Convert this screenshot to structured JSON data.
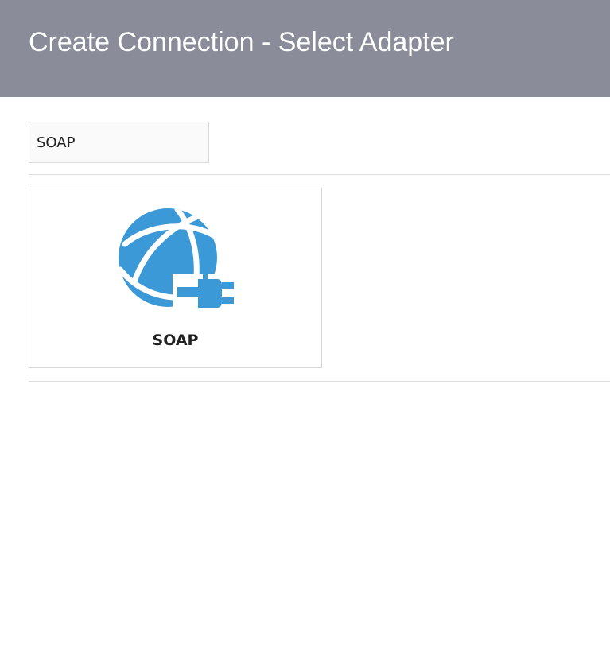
{
  "header": {
    "title": "Create Connection - Select Adapter"
  },
  "search": {
    "value": "SOAP",
    "placeholder": ""
  },
  "adapters": [
    {
      "label": "SOAP",
      "icon": "globe-plug-icon",
      "icon_color": "#3b99d8"
    }
  ],
  "colors": {
    "header_bg": "#8a8d99",
    "accent": "#3b99d8"
  }
}
